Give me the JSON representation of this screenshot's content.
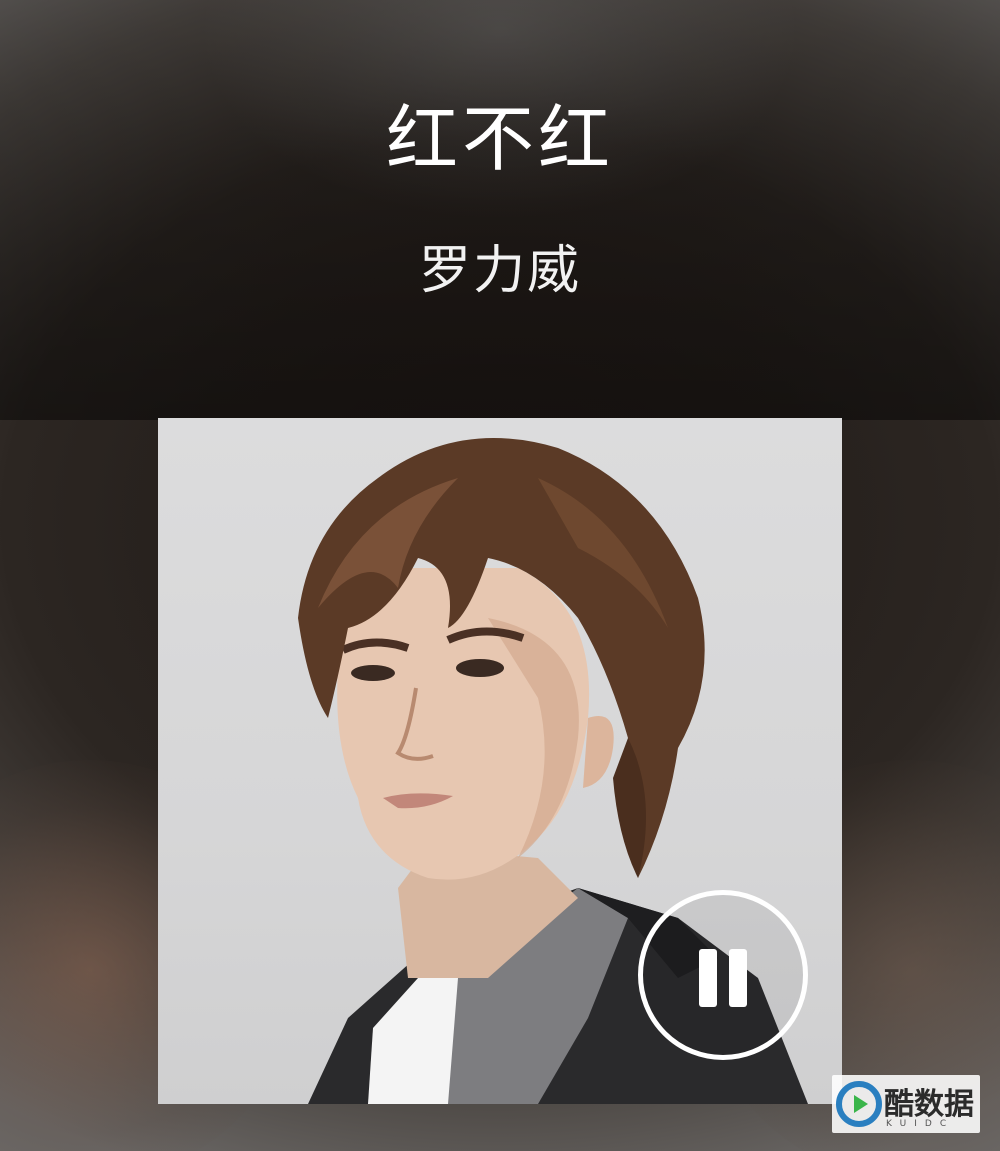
{
  "song": {
    "title": "红不红",
    "artist": "罗力威"
  },
  "player": {
    "control_icon": "pause-icon"
  },
  "watermark": {
    "text": "酷数据",
    "sub": "KUIDC"
  },
  "colors": {
    "text": "#ffffff",
    "cover_bg": "#d8d8d9"
  }
}
